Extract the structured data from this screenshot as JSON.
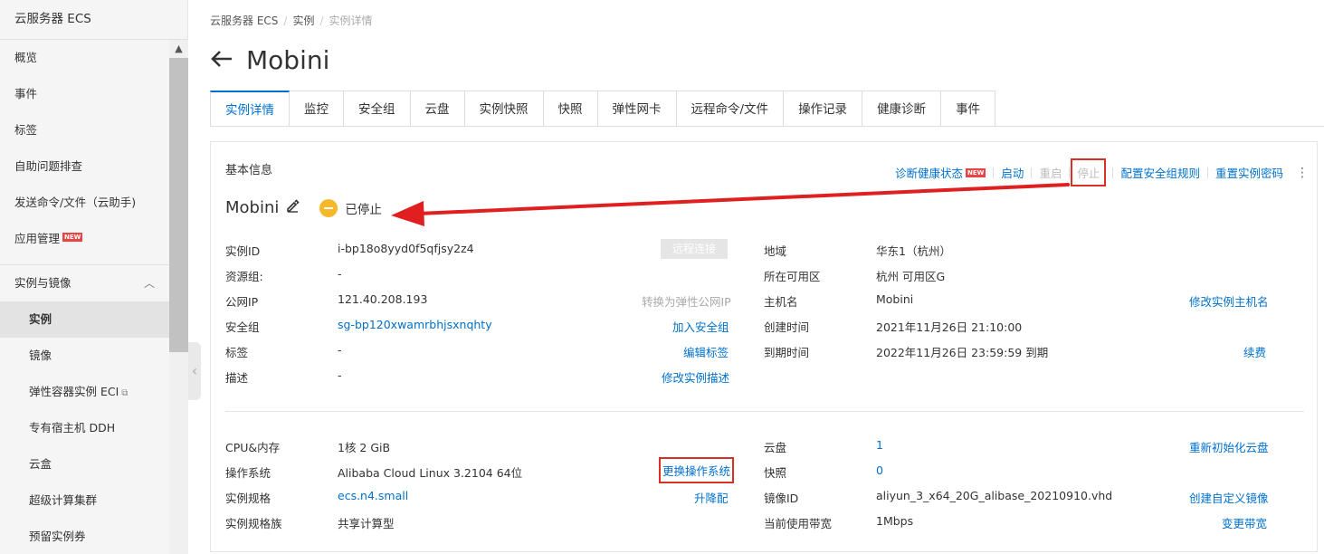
{
  "sidebar": {
    "title": "云服务器 ECS",
    "items": [
      {
        "label": "概览"
      },
      {
        "label": "事件"
      },
      {
        "label": "标签"
      },
      {
        "label": "自助问题排查"
      },
      {
        "label": "发送命令/文件（云助手)"
      },
      {
        "label": "应用管理",
        "badge": "NEW"
      }
    ],
    "group": {
      "label": "实例与镜像"
    },
    "sub_items": [
      {
        "label": "实例"
      },
      {
        "label": "镜像"
      },
      {
        "label": "弹性容器实例 ECI"
      },
      {
        "label": "专有宿主机 DDH"
      },
      {
        "label": "云盒"
      },
      {
        "label": "超级计算集群"
      },
      {
        "label": "预留实例券"
      }
    ]
  },
  "breadcrumb": [
    "云服务器 ECS",
    "实例",
    "实例详情"
  ],
  "page_title": "Mobini",
  "tabs": [
    "实例详情",
    "监控",
    "安全组",
    "云盘",
    "实例快照",
    "快照",
    "弹性网卡",
    "远程命令/文件",
    "操作记录",
    "健康诊断",
    "事件"
  ],
  "panel": {
    "title": "基本信息",
    "actions": {
      "diagnose": "诊断健康状态",
      "diagnose_badge": "NEW",
      "start": "启动",
      "restart": "重启",
      "stop": "停止",
      "sg_rules": "配置安全组规则",
      "reset_pwd": "重置实例密码"
    },
    "instance_name": "Mobini",
    "status": "已停止",
    "left": {
      "id_label": "实例ID",
      "id_value": "i-bp18o8yyd0f5qfjsy2z4",
      "remote_btn": "远程连接",
      "rg_label": "资源组:",
      "rg_value": "-",
      "ip_label": "公网IP",
      "ip_value": "121.40.208.193",
      "ip_action": "转换为弹性公网IP",
      "sg_label": "安全组",
      "sg_value": "sg-bp120xwamrbhjsxnqhty",
      "sg_action": "加入安全组",
      "tag_label": "标签",
      "tag_value": "-",
      "tag_action": "编辑标签",
      "desc_label": "描述",
      "desc_value": "-",
      "desc_action": "修改实例描述"
    },
    "right": {
      "region_label": "地域",
      "region_value": "华东1（杭州）",
      "zone_label": "所在可用区",
      "zone_value": "杭州 可用区G",
      "host_label": "主机名",
      "host_value": "Mobini",
      "host_action": "修改实例主机名",
      "created_label": "创建时间",
      "created_value": "2021年11月26日 21:10:00",
      "expire_label": "到期时间",
      "expire_value": "2022年11月26日 23:59:59 到期",
      "expire_action": "续费"
    },
    "lower_left": {
      "cpu_label": "CPU&内存",
      "cpu_value": "1核 2 GiB",
      "os_label": "操作系统",
      "os_value": "Alibaba Cloud Linux 3.2104 64位",
      "os_action": "更换操作系统",
      "spec_label": "实例规格",
      "spec_value": "ecs.n4.small",
      "spec_action": "升降配",
      "family_label": "实例规格族",
      "family_value": "共享计算型"
    },
    "lower_right": {
      "disk_label": "云盘",
      "disk_value": "1",
      "disk_action": "重新初始化云盘",
      "snap_label": "快照",
      "snap_value": "0",
      "image_label": "镜像ID",
      "image_value": "aliyun_3_x64_20G_alibase_20210910.vhd",
      "image_action": "创建自定义镜像",
      "bw_label": "当前使用带宽",
      "bw_value": "1Mbps",
      "bw_action": "变更带宽"
    }
  },
  "colors": {
    "link": "#0070cc",
    "annotation_red": "#d93026",
    "status_yellow": "#f5b82b"
  }
}
